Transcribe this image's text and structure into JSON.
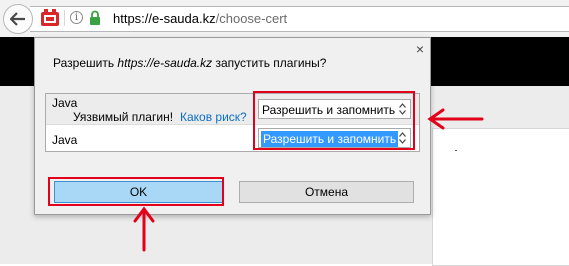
{
  "browser": {
    "url_host": "https://e-sauda.kz",
    "url_path": "/choose-cert"
  },
  "dialog": {
    "title_prefix": "Разрешить ",
    "title_site": "https://e-sauda.kz",
    "title_suffix": " запустить плагины?",
    "plugins": [
      {
        "name": "Java",
        "warning": "Уязвимый плагин!",
        "risk_link": "Каков риск?",
        "action": "Разрешить и запомнить"
      },
      {
        "name": "Java",
        "action": "Разрешить и запомнить"
      }
    ],
    "ok_label": "OK",
    "cancel_label": "Отмена"
  },
  "colors": {
    "highlight_red": "#e2001a",
    "selection_blue": "#3399ff",
    "ok_button": "#a8d8f5",
    "link_blue": "#0b6ec8"
  },
  "icons": [
    "back-arrow-icon",
    "plugin-icon",
    "info-icon",
    "lock-icon",
    "close-icon",
    "select-arrows-icon"
  ]
}
